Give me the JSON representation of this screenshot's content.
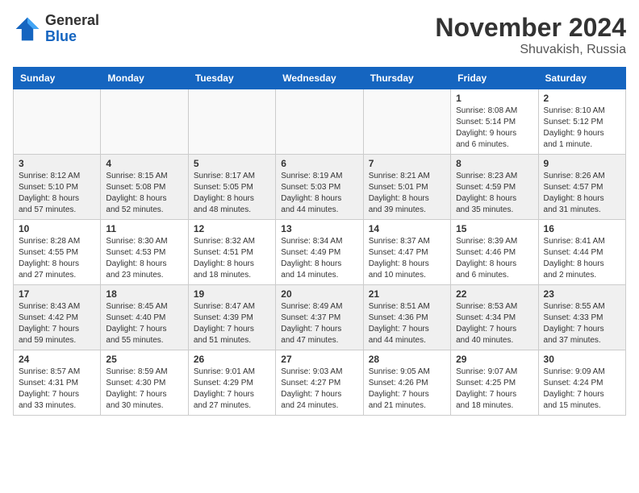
{
  "logo": {
    "general": "General",
    "blue": "Blue"
  },
  "header": {
    "month": "November 2024",
    "location": "Shuvakish, Russia"
  },
  "weekdays": [
    "Sunday",
    "Monday",
    "Tuesday",
    "Wednesday",
    "Thursday",
    "Friday",
    "Saturday"
  ],
  "weeks": [
    [
      {
        "day": "",
        "info": ""
      },
      {
        "day": "",
        "info": ""
      },
      {
        "day": "",
        "info": ""
      },
      {
        "day": "",
        "info": ""
      },
      {
        "day": "",
        "info": ""
      },
      {
        "day": "1",
        "info": "Sunrise: 8:08 AM\nSunset: 5:14 PM\nDaylight: 9 hours\nand 6 minutes."
      },
      {
        "day": "2",
        "info": "Sunrise: 8:10 AM\nSunset: 5:12 PM\nDaylight: 9 hours\nand 1 minute."
      }
    ],
    [
      {
        "day": "3",
        "info": "Sunrise: 8:12 AM\nSunset: 5:10 PM\nDaylight: 8 hours\nand 57 minutes."
      },
      {
        "day": "4",
        "info": "Sunrise: 8:15 AM\nSunset: 5:08 PM\nDaylight: 8 hours\nand 52 minutes."
      },
      {
        "day": "5",
        "info": "Sunrise: 8:17 AM\nSunset: 5:05 PM\nDaylight: 8 hours\nand 48 minutes."
      },
      {
        "day": "6",
        "info": "Sunrise: 8:19 AM\nSunset: 5:03 PM\nDaylight: 8 hours\nand 44 minutes."
      },
      {
        "day": "7",
        "info": "Sunrise: 8:21 AM\nSunset: 5:01 PM\nDaylight: 8 hours\nand 39 minutes."
      },
      {
        "day": "8",
        "info": "Sunrise: 8:23 AM\nSunset: 4:59 PM\nDaylight: 8 hours\nand 35 minutes."
      },
      {
        "day": "9",
        "info": "Sunrise: 8:26 AM\nSunset: 4:57 PM\nDaylight: 8 hours\nand 31 minutes."
      }
    ],
    [
      {
        "day": "10",
        "info": "Sunrise: 8:28 AM\nSunset: 4:55 PM\nDaylight: 8 hours\nand 27 minutes."
      },
      {
        "day": "11",
        "info": "Sunrise: 8:30 AM\nSunset: 4:53 PM\nDaylight: 8 hours\nand 23 minutes."
      },
      {
        "day": "12",
        "info": "Sunrise: 8:32 AM\nSunset: 4:51 PM\nDaylight: 8 hours\nand 18 minutes."
      },
      {
        "day": "13",
        "info": "Sunrise: 8:34 AM\nSunset: 4:49 PM\nDaylight: 8 hours\nand 14 minutes."
      },
      {
        "day": "14",
        "info": "Sunrise: 8:37 AM\nSunset: 4:47 PM\nDaylight: 8 hours\nand 10 minutes."
      },
      {
        "day": "15",
        "info": "Sunrise: 8:39 AM\nSunset: 4:46 PM\nDaylight: 8 hours\nand 6 minutes."
      },
      {
        "day": "16",
        "info": "Sunrise: 8:41 AM\nSunset: 4:44 PM\nDaylight: 8 hours\nand 2 minutes."
      }
    ],
    [
      {
        "day": "17",
        "info": "Sunrise: 8:43 AM\nSunset: 4:42 PM\nDaylight: 7 hours\nand 59 minutes."
      },
      {
        "day": "18",
        "info": "Sunrise: 8:45 AM\nSunset: 4:40 PM\nDaylight: 7 hours\nand 55 minutes."
      },
      {
        "day": "19",
        "info": "Sunrise: 8:47 AM\nSunset: 4:39 PM\nDaylight: 7 hours\nand 51 minutes."
      },
      {
        "day": "20",
        "info": "Sunrise: 8:49 AM\nSunset: 4:37 PM\nDaylight: 7 hours\nand 47 minutes."
      },
      {
        "day": "21",
        "info": "Sunrise: 8:51 AM\nSunset: 4:36 PM\nDaylight: 7 hours\nand 44 minutes."
      },
      {
        "day": "22",
        "info": "Sunrise: 8:53 AM\nSunset: 4:34 PM\nDaylight: 7 hours\nand 40 minutes."
      },
      {
        "day": "23",
        "info": "Sunrise: 8:55 AM\nSunset: 4:33 PM\nDaylight: 7 hours\nand 37 minutes."
      }
    ],
    [
      {
        "day": "24",
        "info": "Sunrise: 8:57 AM\nSunset: 4:31 PM\nDaylight: 7 hours\nand 33 minutes."
      },
      {
        "day": "25",
        "info": "Sunrise: 8:59 AM\nSunset: 4:30 PM\nDaylight: 7 hours\nand 30 minutes."
      },
      {
        "day": "26",
        "info": "Sunrise: 9:01 AM\nSunset: 4:29 PM\nDaylight: 7 hours\nand 27 minutes."
      },
      {
        "day": "27",
        "info": "Sunrise: 9:03 AM\nSunset: 4:27 PM\nDaylight: 7 hours\nand 24 minutes."
      },
      {
        "day": "28",
        "info": "Sunrise: 9:05 AM\nSunset: 4:26 PM\nDaylight: 7 hours\nand 21 minutes."
      },
      {
        "day": "29",
        "info": "Sunrise: 9:07 AM\nSunset: 4:25 PM\nDaylight: 7 hours\nand 18 minutes."
      },
      {
        "day": "30",
        "info": "Sunrise: 9:09 AM\nSunset: 4:24 PM\nDaylight: 7 hours\nand 15 minutes."
      }
    ]
  ]
}
